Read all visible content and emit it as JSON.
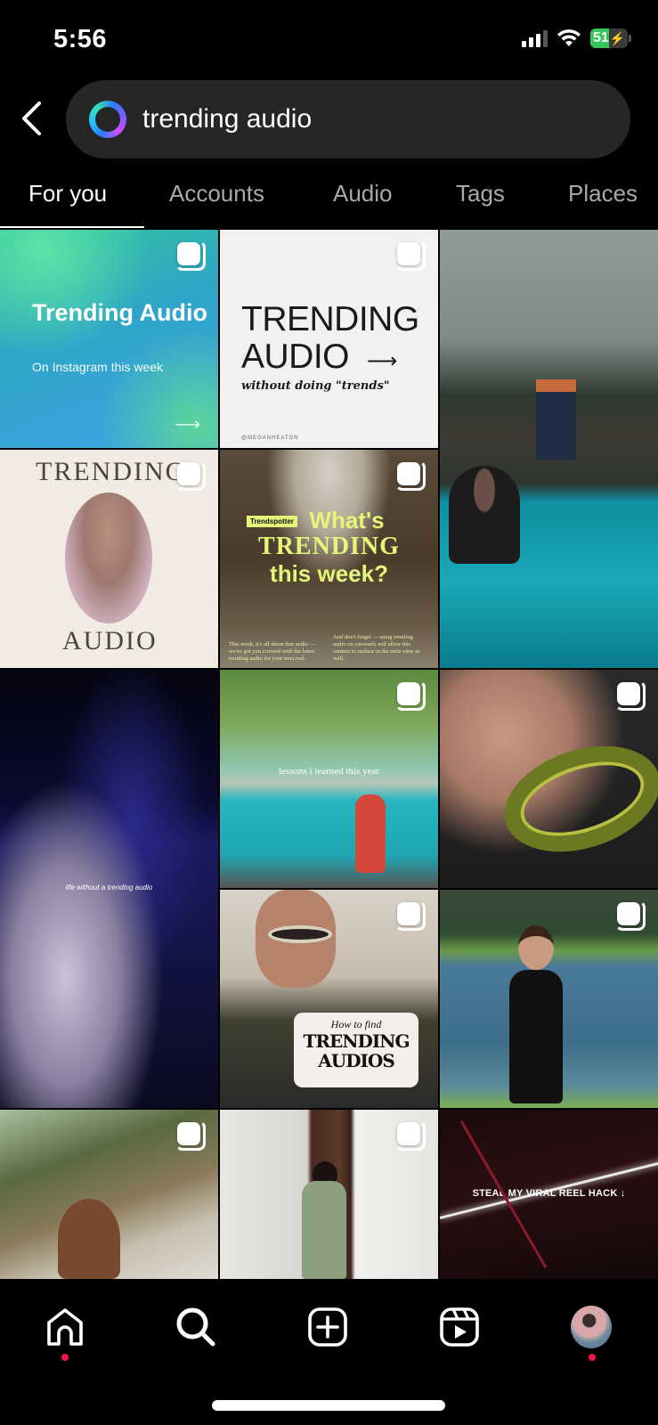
{
  "status_bar": {
    "time": "5:56",
    "battery_level": "51",
    "battery_percent": 51,
    "battery_charging": true,
    "signal_bars_active": 3,
    "signal_bars_total": 4,
    "icons": [
      "cellular-signal-icon",
      "wifi-icon",
      "battery-charging-icon"
    ]
  },
  "search": {
    "back_icon": "chevron-left-icon",
    "ai_icon": "meta-ai-ring-icon",
    "query": "trending audio"
  },
  "tabs": [
    {
      "label": "For you",
      "active": true
    },
    {
      "label": "Accounts",
      "active": false
    },
    {
      "label": "Audio",
      "active": false
    },
    {
      "label": "Tags",
      "active": false
    },
    {
      "label": "Places",
      "active": false
    }
  ],
  "grid": {
    "tiles": [
      {
        "id": "trending-audio-green",
        "type": "carousel",
        "title": "Trending Audio",
        "subtitle": "On Instagram this week",
        "arrow": "⟶"
      },
      {
        "id": "trending-audio-white",
        "type": "carousel",
        "title": "TRENDING AUDIO",
        "arrow": "⟶",
        "subtitle": "without doing \"trends\"",
        "credit": "@MEGANHEATON"
      },
      {
        "id": "pool-reel",
        "type": "reel"
      },
      {
        "id": "trending-audio-oval",
        "type": "carousel",
        "title_top": "TRENDING",
        "title_bottom": "AUDIO"
      },
      {
        "id": "whats-trending",
        "type": "carousel",
        "badge": "Trendspotter",
        "line1": "What's",
        "line2": "TRENDING",
        "line3": "this week?",
        "para_left": "This week, it's all about that audio — we've got you covered with the latest trending audio for your next reel.",
        "para_right": "And don't forget — using trending audio on carousels will allow this content to surface in the reels view as well."
      },
      {
        "id": "night-reel",
        "type": "reel",
        "caption": "life without a trending audio"
      },
      {
        "id": "car-lessons",
        "type": "carousel",
        "caption": "lessons i learned this year"
      },
      {
        "id": "bangles",
        "type": "carousel"
      },
      {
        "id": "how-to-find",
        "type": "carousel",
        "line1": "How to find",
        "line2": "TRENDING",
        "line3": "AUDIOS"
      },
      {
        "id": "river",
        "type": "carousel"
      },
      {
        "id": "tree",
        "type": "carousel"
      },
      {
        "id": "saree",
        "type": "carousel"
      },
      {
        "id": "viral-reel-hack",
        "type": "reel",
        "caption": "STEAL MY VIRAL REEL HACK ↓"
      }
    ]
  },
  "bottom_nav": {
    "items": [
      {
        "name": "home",
        "icon": "home-icon",
        "notification_dot": true
      },
      {
        "name": "search",
        "icon": "search-icon",
        "notification_dot": false,
        "active": true
      },
      {
        "name": "create",
        "icon": "plus-square-icon",
        "notification_dot": false
      },
      {
        "name": "reels",
        "icon": "reels-icon",
        "notification_dot": false
      },
      {
        "name": "profile",
        "icon": "avatar",
        "notification_dot": true
      }
    ]
  },
  "colors": {
    "background": "#000000",
    "search_pill": "#262626",
    "tab_inactive": "#a8a8a8",
    "tab_active": "#ffffff",
    "notification_dot": "#ff0f4b",
    "battery_green": "#34c759"
  }
}
